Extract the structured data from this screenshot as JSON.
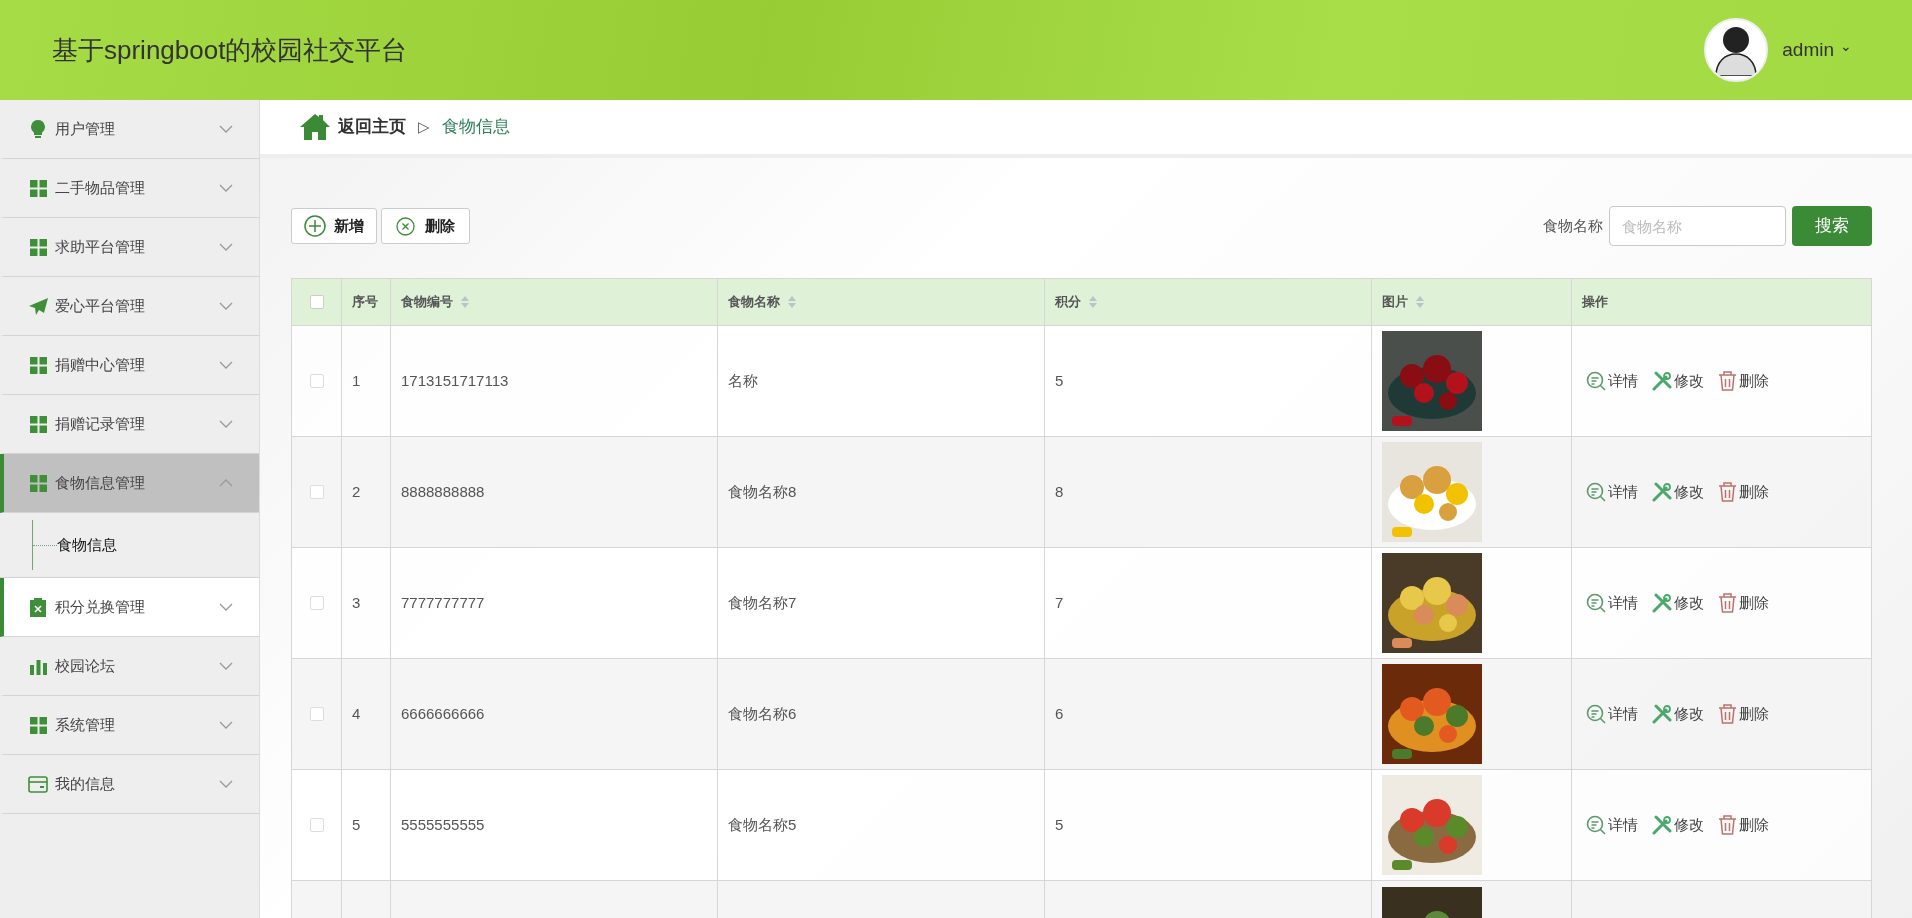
{
  "header": {
    "title": "基于springboot的校园社交平台",
    "user": "admin",
    "caret": "⌄"
  },
  "sidebar": {
    "items": [
      {
        "label": "用户管理",
        "kind": "bulb",
        "expanded": false,
        "hovered": false
      },
      {
        "label": "二手物品管理",
        "kind": "grid",
        "expanded": false,
        "hovered": false
      },
      {
        "label": "求助平台管理",
        "kind": "grid",
        "expanded": false,
        "hovered": false
      },
      {
        "label": "爱心平台管理",
        "kind": "plane",
        "expanded": false,
        "hovered": false
      },
      {
        "label": "捐赠中心管理",
        "kind": "grid",
        "expanded": false,
        "hovered": false
      },
      {
        "label": "捐赠记录管理",
        "kind": "grid",
        "expanded": false,
        "hovered": false
      },
      {
        "label": "食物信息管理",
        "kind": "grid",
        "expanded": true,
        "hovered": false,
        "children": [
          {
            "label": "食物信息"
          }
        ]
      },
      {
        "label": "积分兑换管理",
        "kind": "clipboard",
        "expanded": false,
        "hovered": true
      },
      {
        "label": "校园论坛",
        "kind": "bars",
        "expanded": false,
        "hovered": false
      },
      {
        "label": "系统管理",
        "kind": "grid",
        "expanded": false,
        "hovered": false
      },
      {
        "label": "我的信息",
        "kind": "card",
        "expanded": false,
        "hovered": false
      }
    ]
  },
  "breadcrumb": {
    "home": "返回主页",
    "separator": "▷",
    "current": "食物信息"
  },
  "toolbar": {
    "add": "新增",
    "delete": "删除",
    "search_label": "食物名称",
    "search_placeholder": "食物名称",
    "search_button": "搜索"
  },
  "table": {
    "select_all_checked": false,
    "columns": [
      {
        "label": "序号",
        "sortable": false
      },
      {
        "label": "食物编号",
        "sortable": true
      },
      {
        "label": "食物名称",
        "sortable": true
      },
      {
        "label": "积分",
        "sortable": true
      },
      {
        "label": "图片",
        "sortable": true
      },
      {
        "label": "操作",
        "sortable": false
      }
    ],
    "rows": [
      {
        "checked": false,
        "index": "1",
        "code": "1713151717113",
        "name": "名称",
        "points": "5",
        "actions": [
          "详情",
          "修改",
          "删除"
        ]
      },
      {
        "checked": false,
        "index": "2",
        "code": "8888888888",
        "name": "食物名称8",
        "points": "8",
        "actions": [
          "详情",
          "修改",
          "删除"
        ]
      },
      {
        "checked": false,
        "index": "3",
        "code": "7777777777",
        "name": "食物名称7",
        "points": "7",
        "actions": [
          "详情",
          "修改",
          "删除"
        ]
      },
      {
        "checked": false,
        "index": "4",
        "code": "6666666666",
        "name": "食物名称6",
        "points": "6",
        "actions": [
          "详情",
          "修改",
          "删除"
        ]
      },
      {
        "checked": false,
        "index": "5",
        "code": "5555555555",
        "name": "食物名称5",
        "points": "5",
        "actions": [
          "详情",
          "修改",
          "删除"
        ]
      }
    ]
  }
}
